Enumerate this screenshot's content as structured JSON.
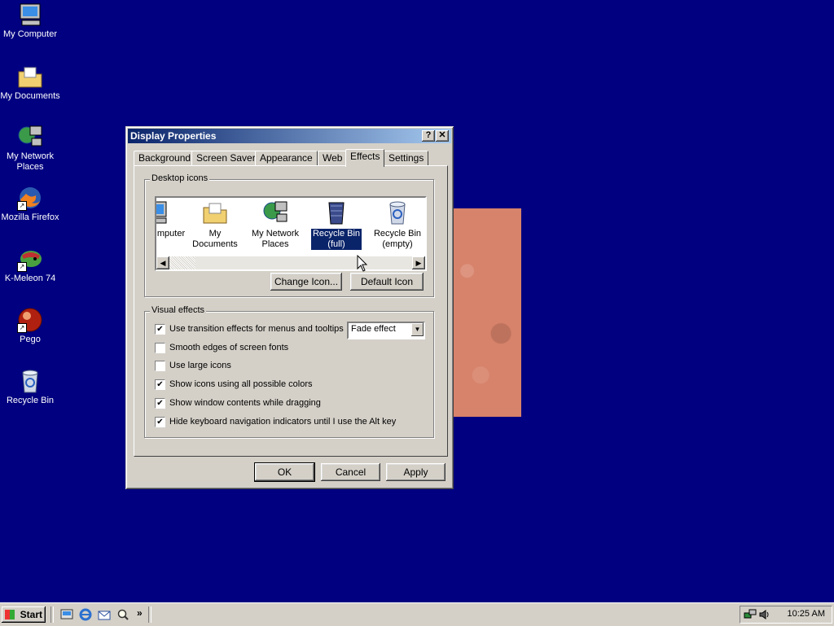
{
  "desktop": {
    "icons": [
      {
        "label": "My Computer",
        "icon": "computer-icon"
      },
      {
        "label": "My Documents",
        "icon": "folder-documents-icon"
      },
      {
        "label": "My Network Places",
        "icon": "network-icon"
      },
      {
        "label": "Mozilla Firefox",
        "icon": "firefox-icon"
      },
      {
        "label": "K-Meleon 74",
        "icon": "kmeleon-icon"
      },
      {
        "label": "Pego",
        "icon": "pego-icon"
      },
      {
        "label": "Recycle Bin",
        "icon": "recycle-bin-icon"
      }
    ]
  },
  "dialog": {
    "title": "Display Properties",
    "help_button": "?",
    "close_button": "✕",
    "tabs": [
      "Background",
      "Screen Saver",
      "Appearance",
      "Web",
      "Effects",
      "Settings"
    ],
    "active_tab": "Effects",
    "desktop_icons_group": {
      "legend": "Desktop icons",
      "items": [
        {
          "label": "Computer",
          "label_visible": "mputer",
          "icon": "computer-icon"
        },
        {
          "label": "My Documents",
          "icon": "folder-documents-icon"
        },
        {
          "label": "My Network Places",
          "line1": "My Network",
          "line2": "Places",
          "icon": "network-icon"
        },
        {
          "label": "Recycle Bin (full)",
          "line1": "Recycle Bin",
          "line2": "(full)",
          "icon": "recycle-bin-full-icon",
          "selected": true
        },
        {
          "label": "Recycle Bin (empty)",
          "line1": "Recycle Bin",
          "line2": "(empty)",
          "icon": "recycle-bin-empty-icon"
        }
      ],
      "scroll_left": "◀",
      "scroll_right": "▶",
      "change_icon_button": "Change Icon...",
      "default_icon_button": "Default Icon"
    },
    "visual_effects_group": {
      "legend": "Visual effects",
      "options": [
        {
          "label": "Use transition effects for menus and tooltips",
          "checked": true
        },
        {
          "label": "Smooth edges of screen fonts",
          "checked": false
        },
        {
          "label": "Use large icons",
          "checked": false
        },
        {
          "label": "Show icons using all possible colors",
          "checked": true
        },
        {
          "label": "Show window contents while dragging",
          "checked": true
        },
        {
          "label": "Hide keyboard navigation indicators until I use the Alt key",
          "checked": true
        }
      ],
      "transition_select": {
        "value": "Fade effect",
        "arrow": "▼"
      }
    },
    "buttons": {
      "ok": "OK",
      "cancel": "Cancel",
      "apply": "Apply"
    }
  },
  "taskbar": {
    "start_label": "Start",
    "quick_launch": [
      "show-desktop-icon",
      "internet-explorer-icon",
      "outlook-express-icon",
      "search-icon"
    ],
    "chevron": "»",
    "clock": "10:25 AM"
  },
  "colors": {
    "desktop": "#000080",
    "titlebar_start": "#0a246a",
    "titlebar_end": "#a6caf0",
    "face": "#d4d0c8",
    "selection": "#0a246a"
  }
}
